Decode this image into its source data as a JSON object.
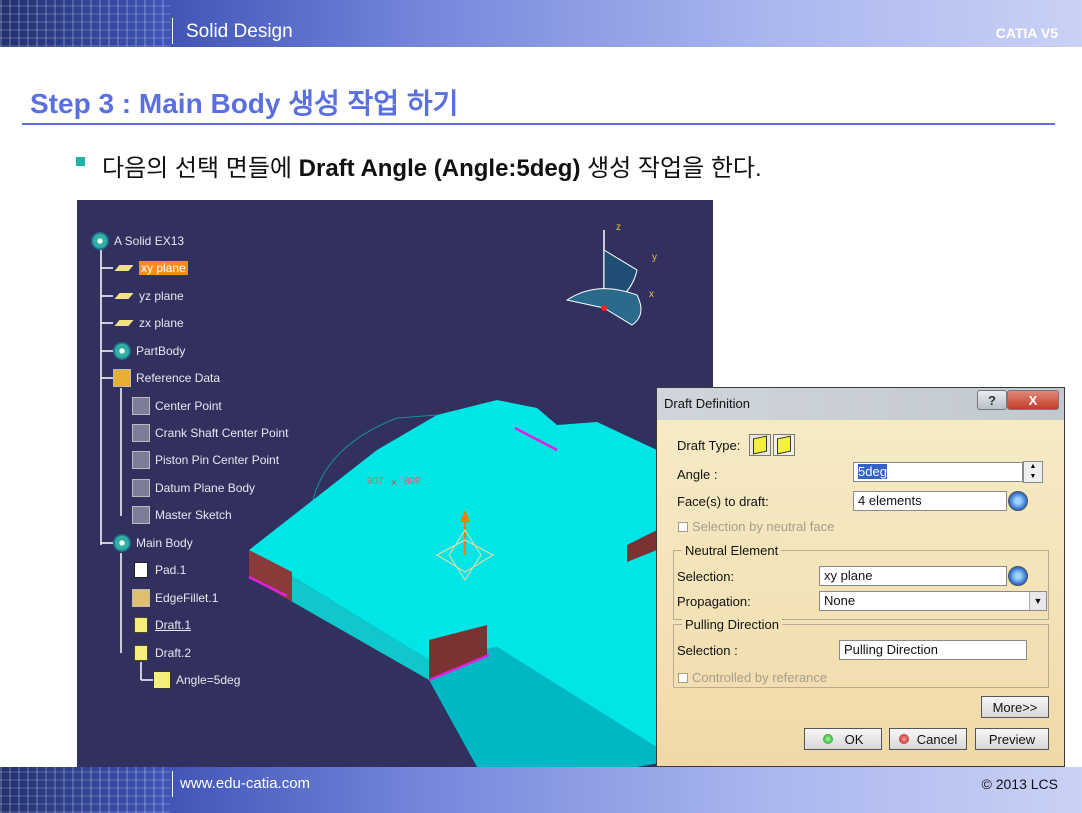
{
  "header": {
    "title": "Solid Design",
    "product": "CATIA V5"
  },
  "step_title": "Step 3 : Main Body 생성 작업 하기",
  "bullet": {
    "prefix": "다음의 선택 면들에 ",
    "bold": "Draft Angle (Angle:5deg)",
    "suffix": " 생성 작업을 한다."
  },
  "tree": {
    "root": "A Solid EX13",
    "items": [
      {
        "label": "xy plane"
      },
      {
        "label": "yz plane"
      },
      {
        "label": "zx plane"
      },
      {
        "label": "PartBody"
      },
      {
        "label": "Reference Data"
      },
      {
        "label": "Center Point"
      },
      {
        "label": "Crank Shaft Center Point"
      },
      {
        "label": "Piston Pin Center Point"
      },
      {
        "label": "Datum Plane Body"
      },
      {
        "label": "Master Sketch"
      },
      {
        "label": "Main Body"
      },
      {
        "label": "Pad.1"
      },
      {
        "label": "EdgeFillet.1"
      },
      {
        "label": "Draft.1"
      },
      {
        "label": "Draft.2"
      },
      {
        "label": "Angle=5deg"
      }
    ]
  },
  "compass": {
    "z": "z",
    "y": "y",
    "x": "x"
  },
  "coords": {
    "a": "907",
    "b": "809"
  },
  "dialog": {
    "title": "Draft Definition",
    "help": "?",
    "close": "X",
    "draft_type_label": "Draft Type:",
    "angle_label": "Angle :",
    "angle_value": "5deg",
    "faces_label": "Face(s) to draft:",
    "faces_value": "4 elements",
    "neutral_face_label": "Selection by neutral face",
    "neutral_group": "Neutral Element",
    "selection_label": "Selection:",
    "selection_value": "xy plane",
    "propagation_label": "Propagation:",
    "propagation_value": "None",
    "pulling_group": "Pulling Direction",
    "pulling_selection_label": "Selection :",
    "pulling_selection_value": "Pulling Direction",
    "controlled_label": "Controlled by referance",
    "more": "More>>",
    "ok": "OK",
    "cancel": "Cancel",
    "preview": "Preview"
  },
  "footer": {
    "url": "www.edu-catia.com",
    "copyright": "© 2013 LCS"
  },
  "colors": {
    "accent": "#5a6fe0",
    "viewport_bg": "#31305e",
    "part": "#00e1e1",
    "highlight": "#ff8c1a",
    "edge_pink": "#e020e0"
  }
}
